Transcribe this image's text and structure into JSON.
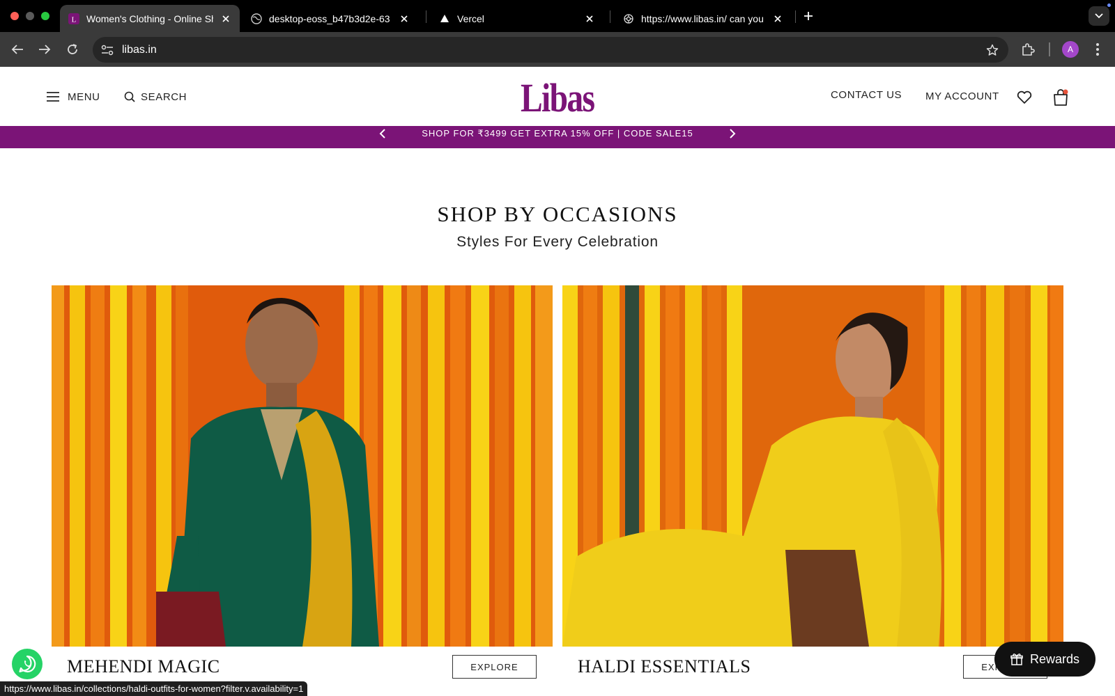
{
  "browser": {
    "tabs": [
      {
        "title": "Women's Clothing - Online Sh",
        "active": true
      },
      {
        "title": "desktop-eoss_b47b3d2e-63"
      },
      {
        "title": "Vercel"
      },
      {
        "title": "https://www.libas.in/ can you"
      }
    ],
    "url": "libas.in",
    "profile_initial": "A",
    "status_url": "https://www.libas.in/collections/haldi-outfits-for-women?filter.v.availability=1"
  },
  "header": {
    "menu_label": "MENU",
    "search_label": "SEARCH",
    "logo_text": "Libas",
    "contact_label": "CONTACT US",
    "account_label": "MY ACCOUNT"
  },
  "promo": {
    "text": "SHOP FOR ₹3499 GET EXTRA 15% OFF | CODE SALE15"
  },
  "section": {
    "title": "SHOP BY OCCASIONS",
    "subtitle": "Styles For Every Celebration"
  },
  "cards": [
    {
      "name": "MEHENDI MAGIC",
      "button": "EXPLORE"
    },
    {
      "name": "HALDI ESSENTIALS",
      "button": "EXPLORE"
    }
  ],
  "widgets": {
    "rewards_label": "Rewards"
  },
  "colors": {
    "brand_purple": "#7b1477",
    "marigold_orange": "#f07a12",
    "marigold_yellow": "#f6c40f"
  }
}
